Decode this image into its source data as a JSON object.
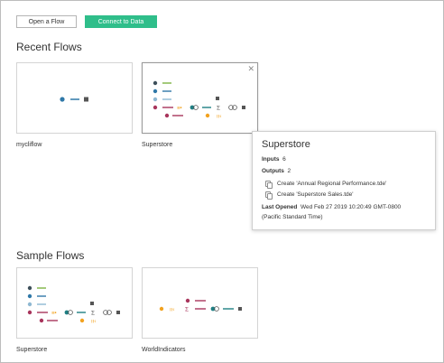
{
  "toolbar": {
    "open_flow_label": "Open a Flow",
    "connect_label": "Connect to Data"
  },
  "recent": {
    "title": "Recent Flows",
    "flows": [
      {
        "name": "mycliflow"
      },
      {
        "name": "Superstore"
      }
    ]
  },
  "sample": {
    "title": "Sample Flows",
    "flows": [
      {
        "name": "Superstore"
      },
      {
        "name": "WorldIndicators"
      }
    ]
  },
  "tooltip": {
    "title": "Superstore",
    "inputs_label": "Inputs",
    "inputs_count": "6",
    "outputs_label": "Outputs",
    "outputs_count": "2",
    "outputs": [
      "Create 'Annual Regional Performance.tde'",
      "Create 'Superstore Sales.tde'"
    ],
    "last_opened_label": "Last Opened",
    "last_opened_value": "Wed Feb 27 2019 10:20:49 GMT-0800",
    "last_opened_tz": "(Pacific Standard Time)"
  },
  "colors": {
    "accent": "#2fbe8a",
    "input_dark": "#3d4f5a",
    "input_blue": "#2f78a8",
    "input_light": "#8fb8d2",
    "input_red": "#a8355c",
    "clean_orange": "#f2a21f",
    "join": "#1f7f83",
    "output": "#555555"
  }
}
